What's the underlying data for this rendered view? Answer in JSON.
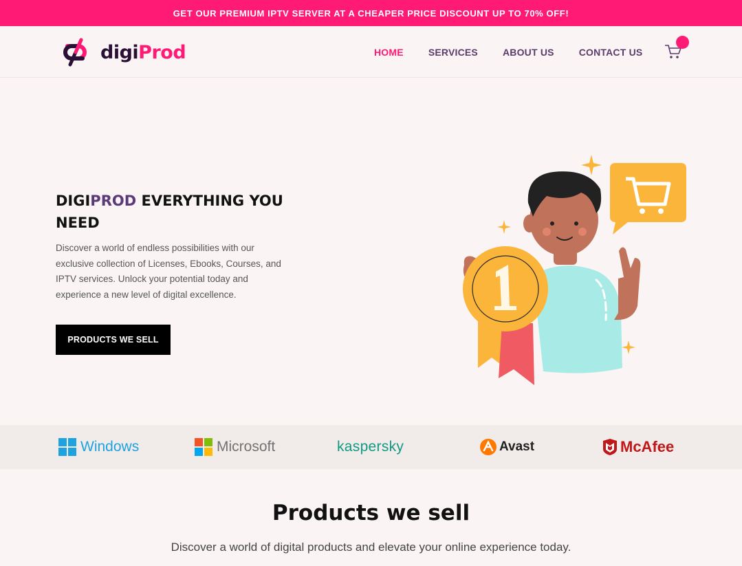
{
  "promo": {
    "text": "GET OUR PREMIUM IPTV SERVER AT A CHEAPER PRICE DISCOUNT UP TO 70% OFF!"
  },
  "header": {
    "logo_part1": "digi",
    "logo_part2": "Prod",
    "nav": [
      {
        "label": "HOME",
        "active": true
      },
      {
        "label": "SERVICES",
        "active": false
      },
      {
        "label": "ABOUT US",
        "active": false
      },
      {
        "label": "CONTACT US",
        "active": false
      }
    ],
    "cart_icon": "shopping-cart-icon"
  },
  "hero": {
    "title_part1": "DIGI",
    "title_part2": "PROD",
    "title_part3": " EVERYTHING YOU NEED",
    "description": "Discover a world of endless possibilities with our exclusive collection of Licenses, Ebooks, Courses, and IPTV services. Unlock your potential today and experience a new level of digital excellence.",
    "button_label": "PRODUCTS WE SELL"
  },
  "brands": [
    {
      "name": "Windows",
      "color": "#1ea3e0"
    },
    {
      "name": "Microsoft",
      "color": "#737373"
    },
    {
      "name": "kaspersky",
      "color": "#0f9a82"
    },
    {
      "name": "Avast",
      "color": "#1f1f1f"
    },
    {
      "name": "McAfee",
      "color": "#c01818"
    }
  ],
  "products_section": {
    "title": "Products we sell",
    "subtitle": "Discover a world of digital products and elevate your online experience today."
  },
  "colors": {
    "brand_pink": "#ff1a75",
    "brand_purple": "#5b3a7a",
    "background": "#faf5f4"
  }
}
